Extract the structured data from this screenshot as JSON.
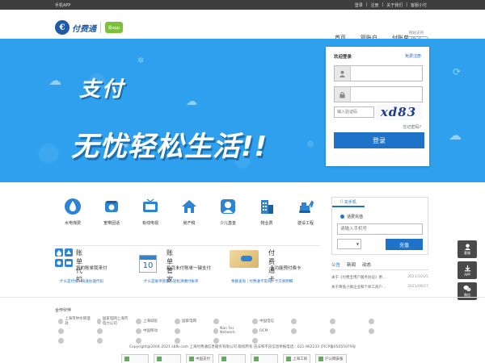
{
  "topbar": {
    "app": "手机APP",
    "login": "登录",
    "register": "注册",
    "about": "关于我们",
    "service": "客服小付"
  },
  "header": {
    "logo_text": "付费通",
    "badge": "易app",
    "nav": [
      "首页",
      "管账户",
      "付账单"
    ],
    "ipv6_caption": "网站支持",
    "ipv6": "IPv6"
  },
  "banner": {
    "slogan_line1": "支付",
    "slogan_line2": "无忧轻松生活!!"
  },
  "login": {
    "title": "欢迎登录",
    "register_link": "免费注册",
    "captcha_placeholder": "输入验证码",
    "captcha_text": "xd83",
    "forgot": "忘记密码?",
    "submit": "登录"
  },
  "services": [
    {
      "label": "水电煤费",
      "icon": "water-drop-icon"
    },
    {
      "label": "宽带固话",
      "icon": "telephone-icon"
    },
    {
      "label": "有线电视",
      "icon": "tv-icon"
    },
    {
      "label": "房产税",
      "icon": "house-icon"
    },
    {
      "label": "少儿基金",
      "icon": "child-icon"
    },
    {
      "label": "物业费",
      "icon": "building-icon"
    },
    {
      "label": "建设工程",
      "icon": "excavator-icon"
    }
  ],
  "recharge": {
    "tab": "充手机",
    "option": "话费充值",
    "phone_placeholder": "请输入手机号",
    "submit": "充值"
  },
  "cards": [
    {
      "title": "账单代扣",
      "desc": "您的账单我来付",
      "links": [
        "什么是代扣",
        "快速办理代扣"
      ]
    },
    {
      "title": "账单管家",
      "desc": "每月未付账单一键支付",
      "calendar": "10",
      "links": [
        "什么是账单管家",
        "轻松清缴付账单"
      ]
    },
    {
      "title": "付费通卡",
      "desc": "多功能预付费卡",
      "links": [
        "余额查询",
        "付费通卡常问",
        "卡交易明细"
      ]
    }
  ],
  "news": {
    "tabs": [
      "公告",
      "新闻",
      "动态"
    ],
    "items": [
      {
        "text": "关于《付费宝用户服务协议》更...",
        "date": "2021/10/25"
      },
      {
        "text": "关于降低小微企业和个体工商户...",
        "date": "2021/09/27"
      }
    ]
  },
  "float": [
    "客服",
    "APP",
    "微信"
  ],
  "footer": {
    "partners_title": "合作伙伴",
    "partners": [
      "上海市供水管理处",
      "国家电网上海市电力公司",
      "上海城投",
      "国家电网",
      "",
      "中国电信",
      "",
      "",
      "",
      "",
      "",
      "中国移动",
      "",
      "Nan Fei Network",
      "OCM",
      "",
      "",
      "",
      "",
      "",
      "",
      "",
      "",
      ""
    ],
    "copyright": "Copyright@2004-2021 sbfb.com 上海付费通信息服务有限公司 版权所有 违法和不良信息举报电话：021-962233 沪ICP备05055979号",
    "badges": [
      "",
      "",
      "中国支付",
      "",
      "",
      "上海工商",
      "沪公网安备"
    ]
  }
}
